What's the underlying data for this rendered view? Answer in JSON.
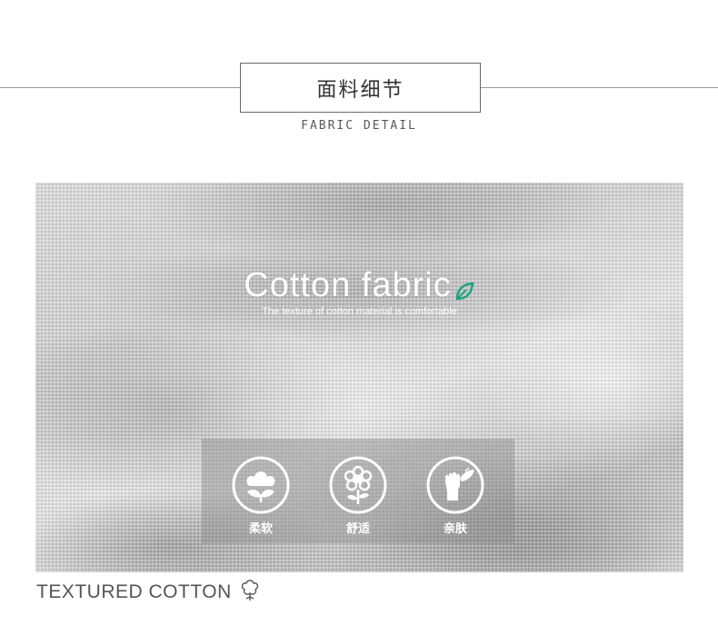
{
  "header": {
    "title": "面料细节",
    "subtitle": "FABRIC DETAIL"
  },
  "hero": {
    "heading": "Cotton fabric",
    "subheading": "The texture of cotton material is comfortable",
    "accent_color": "#1aa37a"
  },
  "features": [
    {
      "icon": "cotton-flower-icon",
      "label": "柔软"
    },
    {
      "icon": "blossom-icon",
      "label": "舒适"
    },
    {
      "icon": "hand-leaf-icon",
      "label": "亲肤"
    }
  ],
  "footer": {
    "text": "TEXTURED COTTON",
    "icon": "cotton-boll-icon"
  }
}
